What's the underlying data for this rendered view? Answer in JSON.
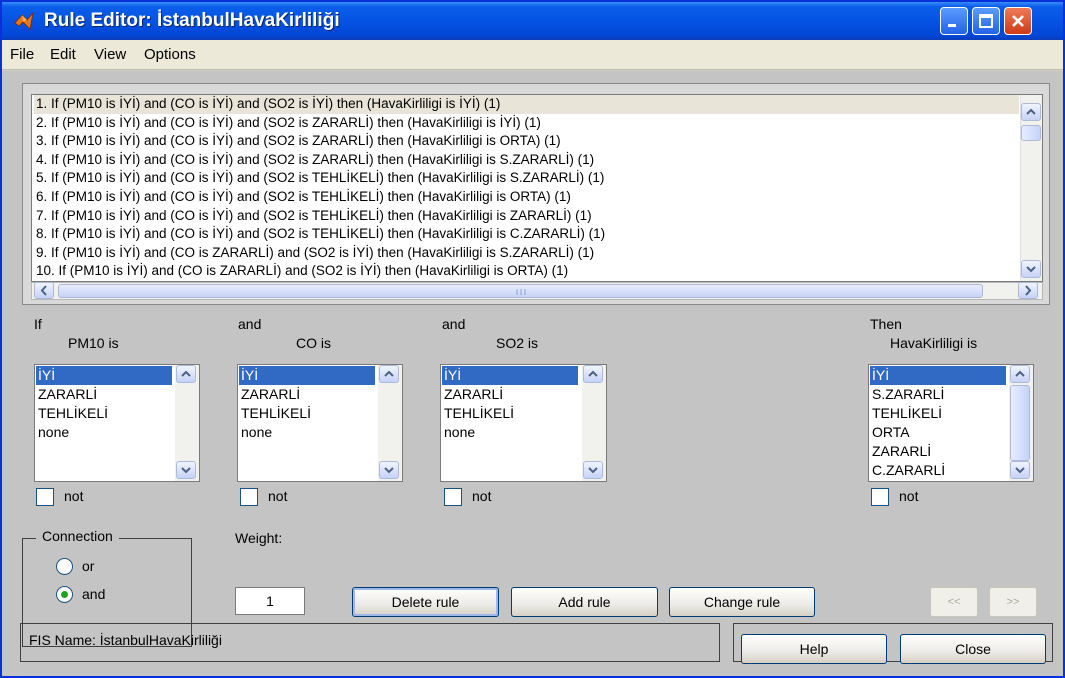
{
  "window": {
    "title": "Rule Editor: İstanbulHavaKirliliği"
  },
  "menu": [
    "File",
    "Edit",
    "View",
    "Options"
  ],
  "rules": [
    "1. If (PM10 is İYİ) and (CO is İYİ) and (SO2 is İYİ) then (HavaKirliligi is İYİ) (1)",
    "2. If (PM10 is İYİ) and (CO is İYİ) and (SO2 is ZARARLİ) then (HavaKirliligi is İYİ) (1)",
    "3. If (PM10 is İYİ) and (CO is İYİ) and (SO2 is ZARARLİ) then (HavaKirliligi is ORTA) (1)",
    "4. If (PM10 is İYİ) and (CO is İYİ) and (SO2 is ZARARLİ) then (HavaKirliligi is S.ZARARLİ) (1)",
    "5. If (PM10 is İYİ) and (CO is İYİ) and (SO2 is TEHLİKELİ) then (HavaKirliligi is S.ZARARLİ) (1)",
    "6. If (PM10 is İYİ) and (CO is İYİ) and (SO2 is TEHLİKELİ) then (HavaKirliligi is ORTA) (1)",
    "7. If (PM10 is İYİ) and (CO is İYİ) and (SO2 is TEHLİKELİ) then (HavaKirliligi is ZARARLİ) (1)",
    "8. If (PM10 is İYİ) and (CO is İYİ) and (SO2 is TEHLİKELİ) then (HavaKirliligi is C.ZARARLİ) (1)",
    "9. If (PM10 is İYİ) and (CO is ZARARLİ) and (SO2 is İYİ) then (HavaKirliligi is S.ZARARLİ) (1)",
    "10. If (PM10 is İYİ) and (CO is ZARARLİ) and (SO2 is İYİ) then (HavaKirliligi is ORTA) (1)"
  ],
  "selected_rule_index": 0,
  "inputs": [
    {
      "prefix": "If",
      "label": "PM10 is",
      "items": [
        "İYİ",
        "ZARARLİ",
        "TEHLİKELİ",
        "none"
      ],
      "selected": "İYİ",
      "not_label": "not"
    },
    {
      "prefix": "and",
      "label": "CO is",
      "items": [
        "İYİ",
        "ZARARLİ",
        "TEHLİKELİ",
        "none"
      ],
      "selected": "İYİ",
      "not_label": "not"
    },
    {
      "prefix": "and",
      "label": "SO2 is",
      "items": [
        "İYİ",
        "ZARARLİ",
        "TEHLİKELİ",
        "none"
      ],
      "selected": "İYİ",
      "not_label": "not"
    }
  ],
  "output": {
    "prefix": "Then",
    "label": "HavaKirliligi is",
    "items": [
      "İYİ",
      "S.ZARARLİ",
      "TEHLİKELİ",
      "ORTA",
      "ZARARLİ",
      "C.ZARARLİ"
    ],
    "selected": "İYİ",
    "not_label": "not"
  },
  "connection": {
    "title": "Connection",
    "options": [
      "or",
      "and"
    ],
    "selected": "and"
  },
  "weight": {
    "label": "Weight:",
    "value": "1"
  },
  "buttons": {
    "delete": "Delete rule",
    "add": "Add rule",
    "change": "Change rule",
    "prev": "<<",
    "next": ">>",
    "help": "Help",
    "close": "Close"
  },
  "status": {
    "fis_name": "FIS Name: İstanbulHavaKirliliği"
  },
  "colors": {
    "selection": "#316ac5",
    "title_bar": "#0553e4",
    "panel": "#c4c4c4"
  }
}
